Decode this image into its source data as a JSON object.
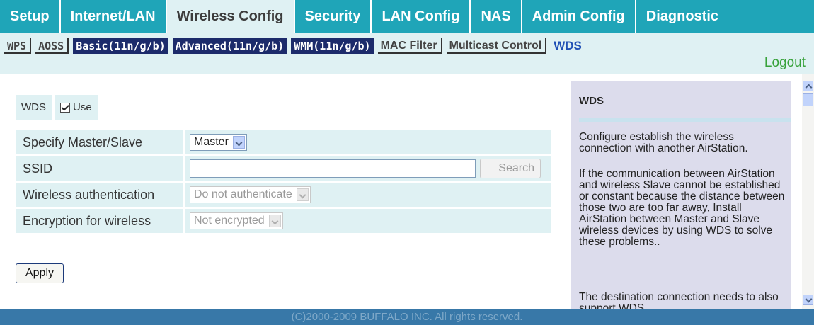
{
  "topnav": {
    "tabs": [
      {
        "label": "Setup"
      },
      {
        "label": "Internet/LAN"
      },
      {
        "label": "Wireless Config"
      },
      {
        "label": "Security"
      },
      {
        "label": "LAN Config"
      },
      {
        "label": "NAS"
      },
      {
        "label": "Admin Config"
      },
      {
        "label": "Diagnostic"
      }
    ],
    "active": "Wireless Config"
  },
  "subnav": {
    "items": [
      {
        "label": "WPS"
      },
      {
        "label": "AOSS"
      },
      {
        "label": "Basic(11n/g/b)"
      },
      {
        "label": "Advanced(11n/g/b)"
      },
      {
        "label": "WMM(11n/g/b)"
      },
      {
        "label": "MAC Filter"
      },
      {
        "label": "Multicast Control"
      },
      {
        "label": "WDS"
      }
    ],
    "current": "WDS",
    "logout": "Logout"
  },
  "form": {
    "wds_label": "WDS",
    "use_label": "Use",
    "use_checked": true,
    "rows": [
      {
        "label": "Specify Master/Slave",
        "value": "Master"
      },
      {
        "label": "SSID",
        "value": "",
        "button": "Search"
      },
      {
        "label": "Wireless authentication",
        "value": "Do not authenticate"
      },
      {
        "label": "Encryption for wireless",
        "value": "Not encrypted"
      }
    ],
    "apply_label": "Apply"
  },
  "help": {
    "title": "WDS",
    "paragraphs": [
      "Configure establish the wireless connection with another AirStation.",
      "If the communication between AirStation and wireless Slave cannot be established or constant because the distance between those two are too far away, Install AirStation between Master and Slave wireless devices by using WDS to solve these problems..",
      "The destination connection needs to also support WDS."
    ]
  },
  "footer": {
    "text": "(C)2000-2009 BUFFALO INC. All rights reserved."
  },
  "icons": {
    "checkbox": "checkmark-icon",
    "dropdown": "chevron-down-icon",
    "scroll_up": "chevron-up-icon",
    "scroll_down": "chevron-down-icon"
  },
  "colors": {
    "nav_bg": "#1fa5b8",
    "nav_active_bg": "#dff1f3",
    "dark_sub": "#1c2b6b",
    "link_green": "#38a23b",
    "footer_bg": "#3878a8",
    "help_bg": "#dcdcec"
  }
}
